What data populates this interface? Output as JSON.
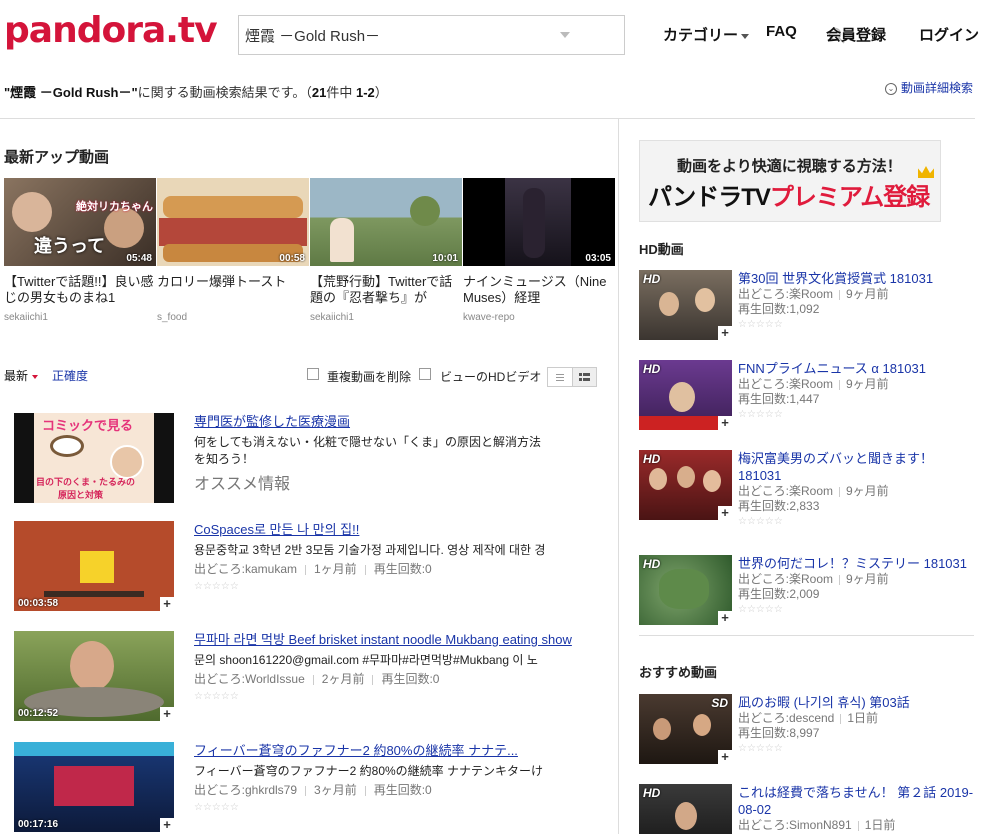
{
  "header": {
    "logo_main": "pandora",
    "logo_tld": ".tv",
    "search_value": "煙霞 －Gold Rush－",
    "nav": {
      "category": "カテゴリー",
      "faq": "FAQ",
      "register": "会員登録",
      "login": "ログイン"
    }
  },
  "result_summary": {
    "query": "\"煙霞 －Gold Rush－\"",
    "middle": "に関する動画検索結果です。（",
    "total": "21",
    "unit": "件中 ",
    "range": "1-2",
    "close": "）"
  },
  "advanced_search": "動画詳細検索",
  "latest_section": {
    "title": "最新アップ動画",
    "items": [
      {
        "title": "【Twitterで話題!!】良い感じの男女ものまね1",
        "user": "sekaiichi1",
        "duration": "05:48",
        "caption1": "絶対リカちゃん",
        "caption2": "違うって",
        "bg": "#6d5a4a"
      },
      {
        "title": "カロリー爆弾トースト",
        "user": "s_food",
        "duration": "00:58",
        "bg": "#c98a4a"
      },
      {
        "title": "【荒野行動】Twitterで話題の『忍者撃ち』が",
        "user": "sekaiichi1",
        "duration": "10:01",
        "bg": "#7f9d6a"
      },
      {
        "title": "ナインミュージス（Nine Muses）経理",
        "user": "kwave-repo",
        "duration": "03:05",
        "bg": "#1b1b24"
      }
    ]
  },
  "sort_bar": {
    "latest": "最新",
    "accuracy": "正確度",
    "remove_dup": "重複動画を削除",
    "hd_only": "ビューのHDビデオ"
  },
  "results": [
    {
      "title": "専門医が監修した医療漫画",
      "desc": "何をしても消えない・化粧で隠せない「くま」の原因と解消方法",
      "desc2": "を知ろう！",
      "promo": "オススメ情報",
      "thumb_title": "コミックで見る",
      "thumb_sub": "目の下のくま・たるみの",
      "thumb_sub2": "原因と対策",
      "bg": "#f6e8d8"
    },
    {
      "title": "CoSpaces로 만든 나 만의 집!!",
      "desc": "용문중학교 3학년 2반 3모둠 기술가정 과제입니다. 영상 제작에 대한 경",
      "source": "出どころ:kamukam",
      "ago": "1ヶ月前",
      "views": "再生回数:0",
      "duration": "00:03:58",
      "bg": "#b84a2a"
    },
    {
      "title": "무파마 라면 먹방 Beef brisket instant noodle Mukbang eating show",
      "desc": "문의 shoon161220@gmail.com #무파마#라면먹방#Mukbang 이 노",
      "source": "出どころ:WorldIssue",
      "ago": "2ヶ月前",
      "views": "再生回数:0",
      "duration": "00:12:52",
      "bg": "#6f8a3c"
    },
    {
      "title": "フィーバー蒼穹のファフナー2 約80%の継続率 ナナテ...",
      "desc": "フィーバー蒼穹のファフナー2 約80%の継続率 ナナテンキターけ",
      "source": "出どころ:ghkrdls79",
      "ago": "3ヶ月前",
      "views": "再生回数:0",
      "duration": "00:17:16",
      "bg": "#2a3f6e"
    }
  ],
  "sidebar": {
    "ad_line1": "動画をより快適に視聴する方法！",
    "ad_line2a": "パンドラTV",
    "ad_line2b": "プレミアム登録",
    "hd_title": "HD動画",
    "hd_items": [
      {
        "title": "第30回 世界文化賞授賞式 181031",
        "source": "出どころ:楽Room",
        "ago": "9ヶ月前",
        "views": "再生回数:1,092",
        "bg": "#5a4f44"
      },
      {
        "title": "FNNプライムニュース α 181031",
        "source": "出どころ:楽Room",
        "ago": "9ヶ月前",
        "views": "再生回数:1,447",
        "bg": "#6a3b8c"
      },
      {
        "title": "梅沢富美男のズバッと聞きます！181031",
        "source": "出どころ:楽Room",
        "ago": "9ヶ月前",
        "views": "再生回数:2,833",
        "bg": "#8c2a2a"
      },
      {
        "title": "世界の何だコレ！？ミステリー 181031",
        "source": "出どころ:楽Room",
        "ago": "9ヶ月前",
        "views": "再生回数:2,009",
        "bg": "#3f6a3a"
      }
    ],
    "hd_badge": "HD",
    "rec_title": "おすすめ動画",
    "rec_items": [
      {
        "title": "凪のお暇 (나기의 휴식) 第03話",
        "source": "出どころ:descend",
        "ago": "1日前",
        "views": "再生回数:8,997",
        "badge": "SD",
        "bg": "#3a2e28"
      },
      {
        "title": "これは経費で落ちません！ 第２話 2019-08-02",
        "source": "出どころ:SimonN891",
        "ago": "1日前",
        "views": "",
        "badge": "HD",
        "bg": "#2b2b2b"
      }
    ]
  }
}
